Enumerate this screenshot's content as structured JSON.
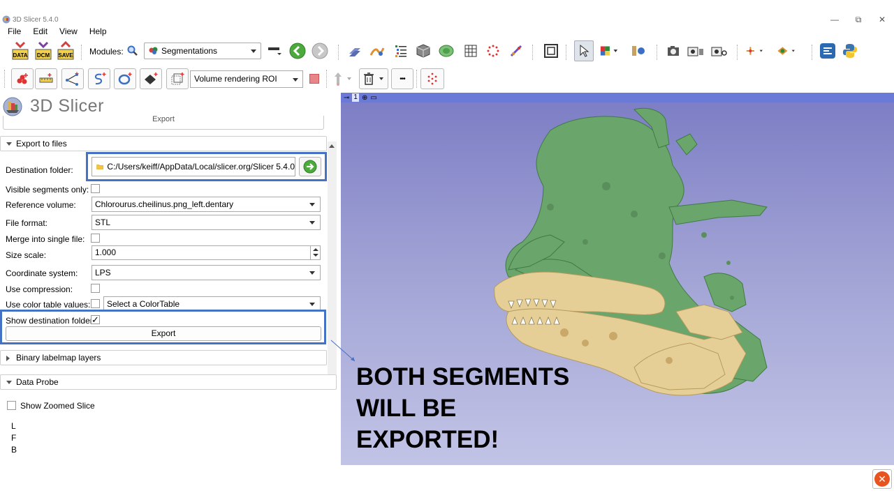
{
  "window": {
    "title": "3D Slicer 5.4.0",
    "controls": [
      "—",
      "⧉",
      "✕"
    ]
  },
  "menu": [
    "File",
    "Edit",
    "View",
    "Help"
  ],
  "toolbar": {
    "data_label": "DATA",
    "dcm_label": "DCM",
    "save_label": "SAVE",
    "modules_label": "Modules:",
    "module_selected": "Segmentations"
  },
  "toolbar2": {
    "roi_selected": "Volume rendering ROI"
  },
  "panel": {
    "logo_text": "3D Slicer",
    "top_export_label": "Export",
    "export_to_files_header": "Export to files",
    "destination_folder_label": "Destination folder:",
    "destination_folder_value": "C:/Users/keiff/AppData/Local/slicer.org/Slicer 5.4.0",
    "visible_segments_label": "Visible segments only:",
    "visible_segments_checked": false,
    "reference_volume_label": "Reference volume:",
    "reference_volume_value": "Chlorourus.cheilinus.png_left.dentary",
    "file_format_label": "File format:",
    "file_format_value": "STL",
    "merge_label": "Merge into single file:",
    "merge_checked": false,
    "size_scale_label": "Size scale:",
    "size_scale_value": "1.000",
    "coordinate_system_label": "Coordinate system:",
    "coordinate_system_value": "LPS",
    "use_compression_label": "Use compression:",
    "use_compression_checked": false,
    "use_color_table_label": "Use color table values:",
    "use_color_table_checked": false,
    "color_table_value": "Select a ColorTable",
    "show_destination_label": "Show destination folder:",
    "show_destination_checked": true,
    "check_mark": "✓",
    "export_button_label": "Export",
    "binary_labelmap_header": "Binary labelmap layers",
    "data_probe_header": "Data Probe",
    "show_zoomed_slice_label": "Show Zoomed Slice",
    "probe_lines": [
      "L",
      "F",
      "B"
    ]
  },
  "view": {
    "view_number": "1",
    "segment_colors": {
      "bone": "#e6cf96",
      "tissue": "#6aa56c"
    }
  },
  "annotation": {
    "lines": [
      "BOTH SEGMENTS",
      "WILL BE",
      "EXPORTED!"
    ]
  },
  "highlight_color": "#4472c4"
}
